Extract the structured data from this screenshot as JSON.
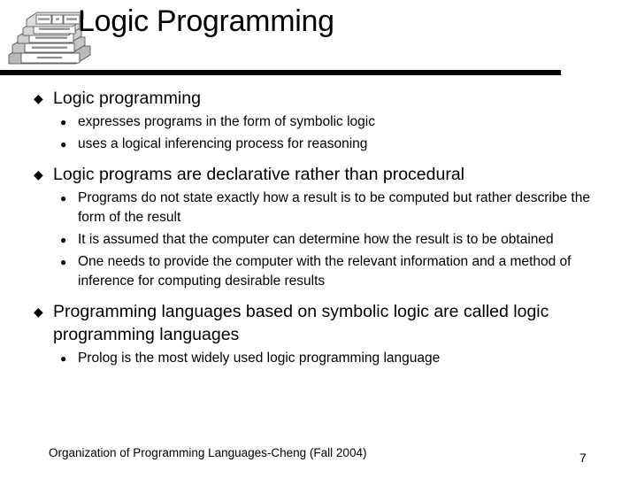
{
  "slide": {
    "title": "Logic Programming",
    "logo_icon": "stacked-layers-pyramid-icon",
    "bullet_glyphs": {
      "level1": "◆",
      "level2": "●"
    },
    "accent_color": "#000000",
    "background_color": "#ffffff",
    "bullets": [
      {
        "text": "Logic programming",
        "sub": [
          "expresses programs in the form of symbolic logic",
          "uses a logical inferencing process for reasoning"
        ]
      },
      {
        "text": "Logic programs are declarative rather than procedural",
        "sub": [
          "Programs do not state exactly how a result is to be computed but rather describe the form of the result",
          "It is assumed that the computer can determine how the result is to be obtained",
          "One needs to provide the computer with the relevant information and a method of inference for computing desirable results"
        ]
      },
      {
        "text": "Programming languages based on symbolic logic are called logic programming languages",
        "sub": [
          "Prolog is the most widely used logic programming language"
        ]
      }
    ],
    "footer": {
      "text": "Organization of Programming Languages-Cheng (Fall 2004)",
      "page_number": "7"
    }
  }
}
